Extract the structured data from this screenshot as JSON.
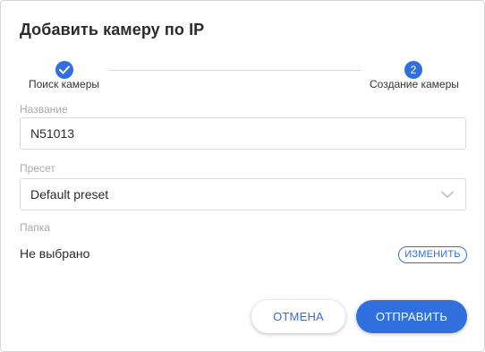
{
  "dialog": {
    "title": "Добавить камеру по IP"
  },
  "stepper": {
    "steps": [
      {
        "label": "Поиск камеры",
        "state": "completed",
        "icon": "check-icon"
      },
      {
        "label": "Создание камеры",
        "state": "active",
        "number": "2"
      }
    ]
  },
  "form": {
    "name": {
      "label": "Название",
      "value": "N51013"
    },
    "preset": {
      "label": "Пресет",
      "value": "Default preset",
      "icon": "chevron-down-icon"
    },
    "folder": {
      "label": "Папка",
      "value": "Не выбрано",
      "change_label": "ИЗМЕНИТЬ"
    }
  },
  "footer": {
    "cancel_label": "ОТМЕНА",
    "submit_label": "ОТПРАВИТЬ"
  },
  "colors": {
    "accent": "#2f6fde",
    "text": "#2b2b2b",
    "muted": "#a9a9a9",
    "border": "#dadada"
  }
}
